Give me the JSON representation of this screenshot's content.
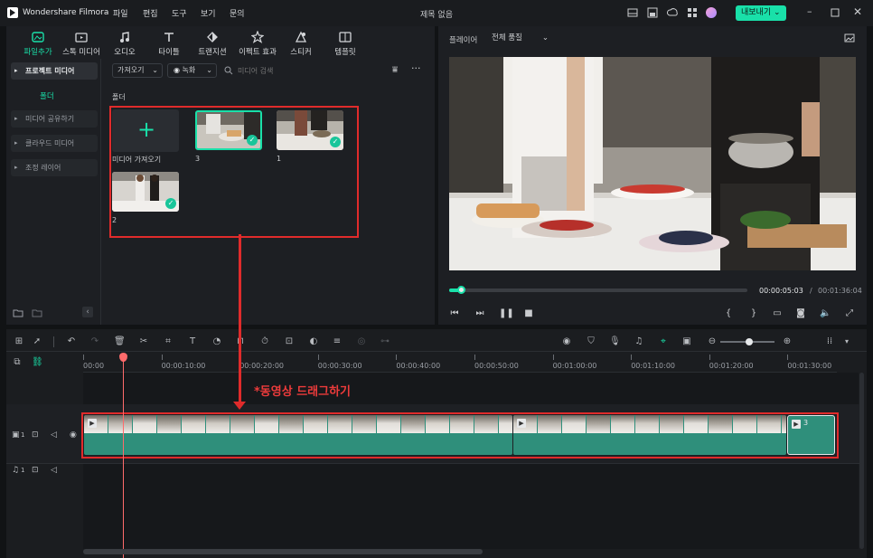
{
  "app": {
    "name": "Wondershare Filmora",
    "doc_title": "제목 없음",
    "export_label": "내보내기 ⌄"
  },
  "menu": [
    "파일",
    "편집",
    "도구",
    "보기",
    "문의"
  ],
  "toolbar": [
    {
      "label": "파일추가",
      "icon": "media-icon",
      "active": true
    },
    {
      "label": "스톡 미디어",
      "icon": "stock-icon",
      "active": false
    },
    {
      "label": "오디오",
      "icon": "music-icon",
      "active": false
    },
    {
      "label": "타이틀",
      "icon": "title-icon",
      "active": false
    },
    {
      "label": "트랜지션",
      "icon": "transition-icon",
      "active": false
    },
    {
      "label": "이펙트 효과",
      "icon": "effects-icon",
      "active": false
    },
    {
      "label": "스티커",
      "icon": "sticker-icon",
      "active": false
    },
    {
      "label": "템플릿",
      "icon": "template-icon",
      "active": false
    }
  ],
  "sidebar": {
    "project_media": "프로젝트 미디어",
    "folder": "폴더",
    "items": [
      "미디어 공유하기",
      "클라우드 미디어",
      "조정 레이어"
    ]
  },
  "media": {
    "import_dropdown": "가져오기",
    "record_dropdown": "녹화",
    "search_placeholder": "미디어 검색",
    "folder_label": "폴더",
    "import_tile": "미디어 가져오기",
    "clips": [
      "3",
      "1",
      "2"
    ]
  },
  "player": {
    "label": "플레이어",
    "quality": "전체 품질",
    "current_time": "00:00:05:03",
    "separator": "/",
    "total_time": "00:01:36:04",
    "progress": 0.04
  },
  "timeline": {
    "ticks": [
      "00:00",
      "00:00:10:00",
      "00:00:20:00",
      "00:00:30:00",
      "00:00:40:00",
      "00:00:50:00",
      "00:01:00:00",
      "00:01:10:00",
      "00:01:20:00",
      "00:01:30:00"
    ],
    "video_track": "1",
    "audio_track": "1",
    "clip_label": "3"
  },
  "annotation": "*동영상 드래그하기",
  "colors": {
    "accent": "#19e0a9",
    "annotation_red": "#e02b2b",
    "clip_teal": "#2f8f7b"
  }
}
